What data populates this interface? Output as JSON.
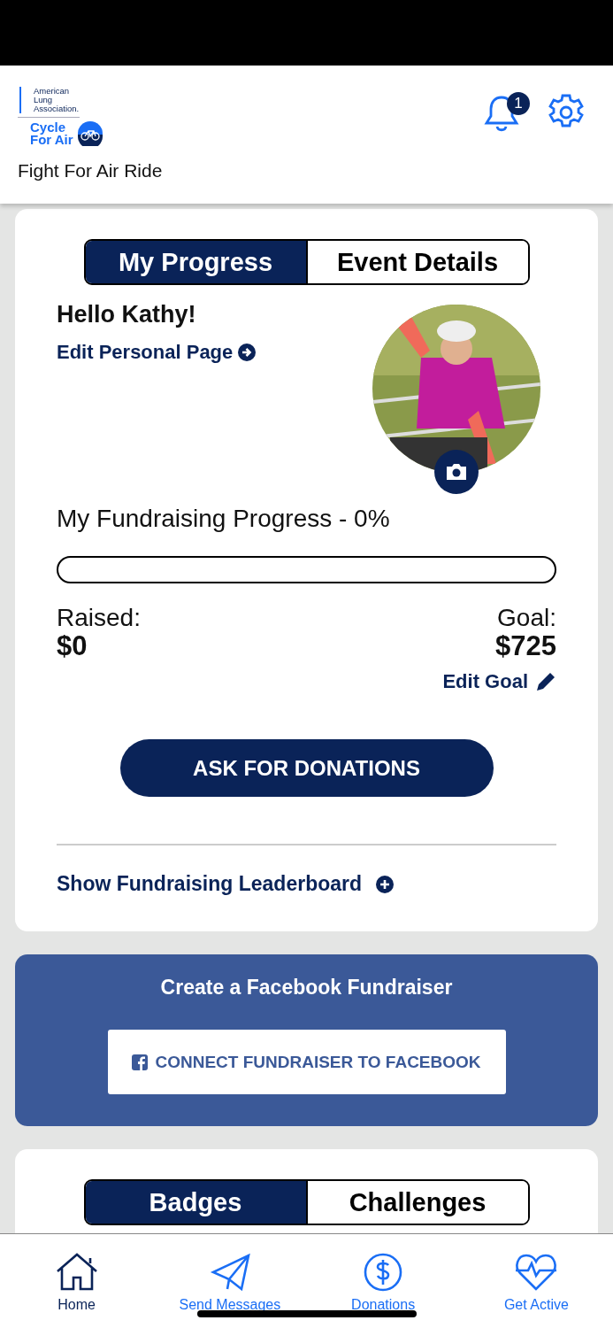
{
  "header": {
    "logo_org": "American Lung Association.",
    "logo_event": "Cycle For Air",
    "title": "Fight For Air Ride",
    "notification_count": "1"
  },
  "progress_tabs": [
    {
      "label": "My Progress",
      "selected": true
    },
    {
      "label": "Event Details",
      "selected": false
    }
  ],
  "greeting": "Hello Kathy!",
  "edit_page_link": "Edit Personal Page",
  "fundraising": {
    "title": "My Fundraising Progress - 0%",
    "raised_label": "Raised:",
    "raised": "$0",
    "goal_label": "Goal:",
    "goal": "$725",
    "edit_goal": "Edit Goal"
  },
  "ask_button": "ASK FOR DONATIONS",
  "leaderboard_link": "Show Fundraising Leaderboard",
  "facebook": {
    "title": "Create a Facebook Fundraiser",
    "button": "CONNECT FUNDRAISER TO FACEBOOK"
  },
  "badge_tabs": [
    {
      "label": "Badges",
      "selected": true
    },
    {
      "label": "Challenges",
      "selected": false
    }
  ],
  "nav": [
    {
      "kind": "home",
      "label": "Home",
      "selected": true
    },
    {
      "kind": "send",
      "label": "Send Messages",
      "selected": false
    },
    {
      "kind": "donate",
      "label": "Donations",
      "selected": false
    },
    {
      "kind": "active",
      "label": "Get Active",
      "selected": false
    }
  ]
}
